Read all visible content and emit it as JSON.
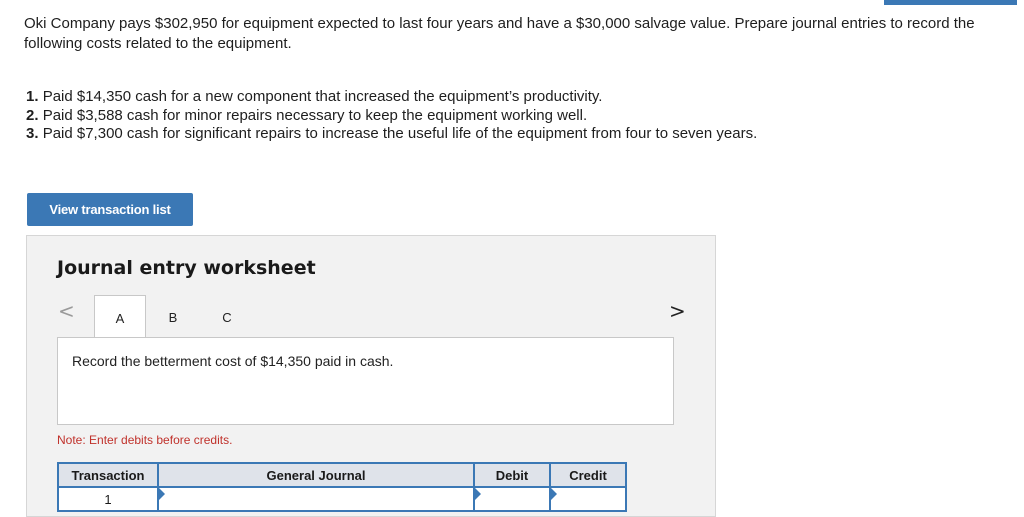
{
  "intro": "Oki Company pays $302,950 for equipment expected to last four years and have a $30,000 salvage value. Prepare journal entries to record the following costs related to the equipment.",
  "requirements": [
    {
      "num": "1.",
      "text": "Paid $14,350 cash for a new component that increased the equipment’s productivity."
    },
    {
      "num": "2.",
      "text": "Paid $3,588 cash for minor repairs necessary to keep the equipment working well."
    },
    {
      "num": "3.",
      "text": "Paid $7,300 cash for significant repairs to increase the useful life of the equipment from four to seven years."
    }
  ],
  "view_button": "View transaction list",
  "worksheet": {
    "title": "Journal entry worksheet",
    "tabs": [
      "A",
      "B",
      "C"
    ],
    "active_tab": "A",
    "prompt": "Record the betterment cost of $14,350 paid in cash.",
    "note": "Note: Enter debits before credits.",
    "columns": [
      "Transaction",
      "General Journal",
      "Debit",
      "Credit"
    ],
    "rows": [
      {
        "transaction": "1"
      }
    ]
  },
  "colors": {
    "accent": "#3b78b5",
    "note": "#c0312b"
  },
  "icons": {
    "prev": "chevron-left-icon",
    "next": "chevron-right-icon"
  }
}
